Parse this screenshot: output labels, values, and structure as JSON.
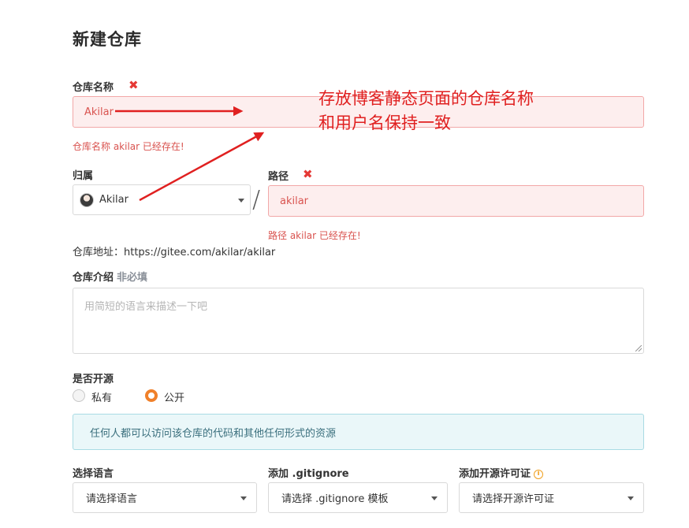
{
  "page": {
    "title": "新建仓库"
  },
  "repo_name": {
    "label": "仓库名称",
    "required_mark": "✖",
    "value": "Akilar",
    "error": "仓库名称 akilar 已经存在!"
  },
  "owner": {
    "label": "归属",
    "value": "Akilar"
  },
  "separator": "/",
  "path": {
    "label": "路径",
    "required_mark": "✖",
    "value": "akilar",
    "error": "路径 akilar 已经存在!"
  },
  "address": {
    "text": "仓库地址：https://gitee.com/akilar/akilar"
  },
  "description": {
    "label": "仓库介绍",
    "optional": "非必填",
    "placeholder": "用简短的语言来描述一下吧"
  },
  "visibility": {
    "label": "是否开源",
    "options": [
      {
        "label": "私有",
        "selected": false
      },
      {
        "label": "公开",
        "selected": true
      }
    ],
    "notice": "任何人都可以访问该仓库的代码和其他任何形式的资源"
  },
  "language": {
    "label": "选择语言",
    "value": "请选择语言"
  },
  "gitignore": {
    "label": "添加 .gitignore",
    "value": "请选择 .gitignore 模板"
  },
  "license": {
    "label": "添加开源许可证",
    "value": "请选择开源许可证",
    "icon": "info-icon"
  },
  "annotation": {
    "line1": "存放博客静态页面的仓库名称",
    "line2": "和用户名保持一致",
    "color": "#e02020"
  },
  "colors": {
    "error": "#d9534f",
    "error_bg": "#fdeeee",
    "radio_accent": "#f0802a",
    "info_bg": "#eaf7f9"
  }
}
